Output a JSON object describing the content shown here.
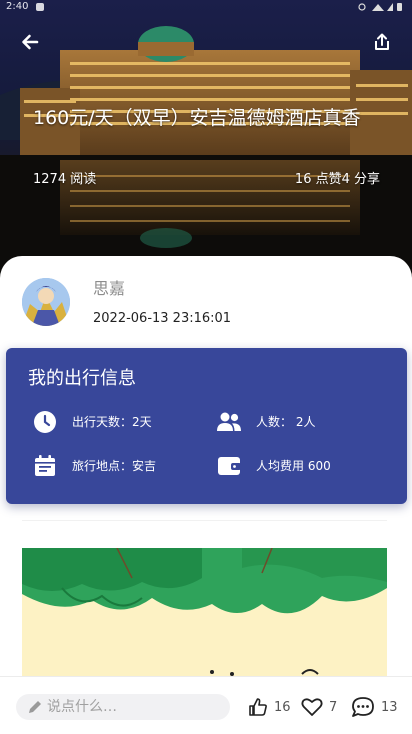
{
  "status_bar": {
    "time": "2:40"
  },
  "header": {
    "back_icon": "arrow-left-icon",
    "share_icon": "share-icon"
  },
  "article": {
    "title": "160元/天（双早）安吉温德姆酒店真香",
    "reads": "1274 阅读",
    "stats": "16 点赞4 分享"
  },
  "author": {
    "name": "思嘉",
    "date": "2022-06-13 23:16:01"
  },
  "trip_info": {
    "title": "我的出行信息",
    "days": "出行天数：2天",
    "people": "人数：  2人",
    "location": "旅行地点：安吉",
    "cost": "人均费用 600"
  },
  "bottom_bar": {
    "comment_placeholder": "说点什么…",
    "likes": "16",
    "favorites": "7",
    "comments": "13"
  },
  "colors": {
    "card": "#38479a",
    "hero_sky": "#1b1f4a"
  }
}
